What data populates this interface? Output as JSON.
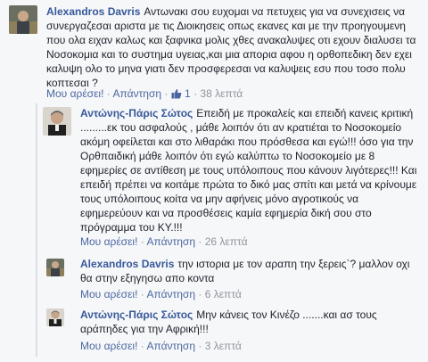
{
  "comments": [
    {
      "author": "Alexandros Davris",
      "text": "Αντωνακι σου ευχομαι να πετυχεις για να συνεχισεις να συνεργαζεσαι αριστα με τις Διοικησεις οπως εκανες και με την προηγουμενη που ολα ειχαν καλως και ξαφνικα μολις χθες ανακαλυψες οτι εχουν διαλυσει τα Νοσοκομια και το συστημα υγειας,και μια απορια αφου η ορθοπεδικη δεν εχει καλυψη ολο το μηνα γιατι δεν προσφερεσαι να καλυψεις εσυ που τοσο πολυ κοπτεσαι ?",
      "like_label": "Μου αρέσει!",
      "reply_label": "Απάντηση",
      "like_count": "1",
      "time": "38 λεπτά"
    },
    {
      "author": "Αντώνης-Πάρις Σώτος",
      "text": "Επειδή με προκαλείς και επειδή κανεις κριτική .........εκ του ασφαλούς , μάθε λοιπόν ότι αν κρατιέται το Νοσοκομείο ακόμη οφείλεται και στο λιθαράκι που πρόσθεσα και εγώ!!! όσο για την Ορθπαιδική μάθε λοιπόν ότι εγώ καλύπτω το Νοσοκομείο με 8 εφημερίες σε αντίθεση με τους υπόλοιπους που κάνουν λιγότερες!!! Και επειδή πρέπει να κοιτάμε πρώτα το δικό μας σπίτι και μετά να κρίνουμε τους υπόλοιπους κοίτα να μην αφήνεις μόνο αγροτικούς να εφημερεύουν και να προσθέσεις καμία εφημερία δική σου στο πρόγραμμα του ΚΥ.!!!",
      "like_label": "Μου αρέσει!",
      "reply_label": "Απάντηση",
      "time": "26 λεπτά"
    },
    {
      "author": "Alexandros Davris",
      "text": "την ιστορια με τον αραπη την ξερεις`? μαλλον οχι θα στην εξηγησω απο κοντα",
      "like_label": "Μου αρέσει!",
      "reply_label": "Απάντηση",
      "time": "6 λεπτά"
    },
    {
      "author": "Αντώνης-Πάρις Σώτος",
      "text": "Μην κάνεις τον Κινέζο .......και ασ τους αράπηδες για την Αφρική!!!",
      "like_label": "Μου αρέσει!",
      "reply_label": "Απάντηση",
      "time": "3 λεπτά"
    }
  ],
  "colors": {
    "link": "#365899",
    "meta": "#90949c",
    "background": "#f6f7f9"
  }
}
